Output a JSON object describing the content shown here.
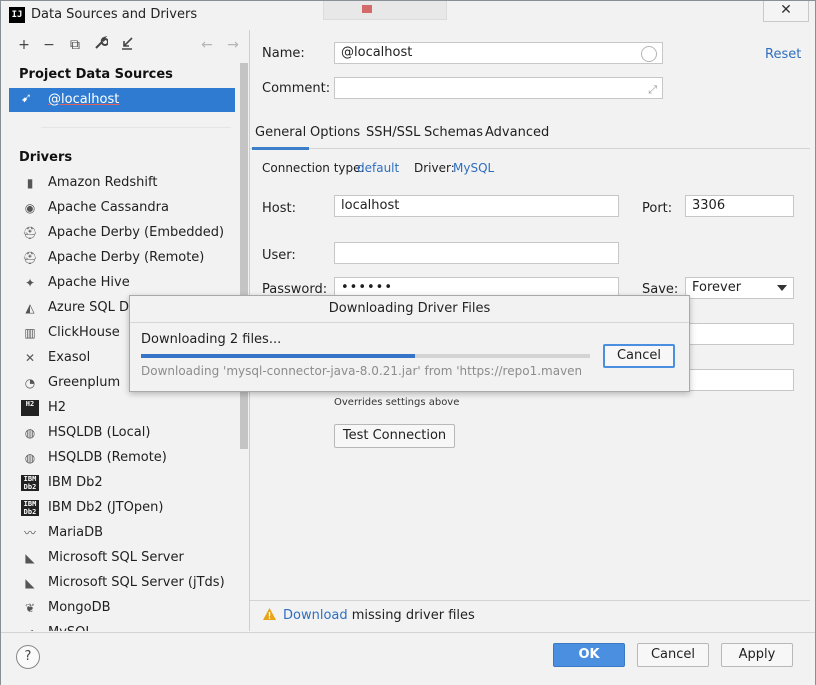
{
  "window": {
    "title": "Data Sources and Drivers",
    "app_icon_text": "IJ",
    "close_glyph": "✕"
  },
  "sidebar": {
    "toolbar": [
      {
        "icon": "plus-icon",
        "glyph": "+"
      },
      {
        "icon": "minus-icon",
        "glyph": "−"
      },
      {
        "icon": "copy-icon",
        "glyph": "⧉"
      },
      {
        "icon": "wrench-icon",
        "glyph": "🔧"
      },
      {
        "icon": "import-icon",
        "glyph": "⇲"
      },
      {
        "icon": "back-arrow-icon",
        "glyph": "←"
      },
      {
        "icon": "forward-arrow-icon",
        "glyph": "→"
      }
    ],
    "project_title": "Project Data Sources",
    "datasource": {
      "label": "@localhost",
      "icon": "mysql-dolphin-icon",
      "glyph": "➹"
    },
    "drivers_title": "Drivers",
    "drivers": [
      {
        "label": "Amazon Redshift",
        "icon": "redshift-icon",
        "glyph": "▮"
      },
      {
        "label": "Apache Cassandra",
        "icon": "cassandra-eye-icon",
        "glyph": "◉"
      },
      {
        "label": "Apache Derby (Embedded)",
        "icon": "derby-hat-icon",
        "glyph": "⛑"
      },
      {
        "label": "Apache Derby (Remote)",
        "icon": "derby-hat-icon",
        "glyph": "⛑"
      },
      {
        "label": "Apache Hive",
        "icon": "hive-bee-icon",
        "glyph": "✦"
      },
      {
        "label": "Azure SQL Database",
        "icon": "azure-icon",
        "glyph": "◭"
      },
      {
        "label": "ClickHouse",
        "icon": "clickhouse-bars-icon",
        "glyph": "▥"
      },
      {
        "label": "Exasol",
        "icon": "exasol-x-icon",
        "glyph": "✕"
      },
      {
        "label": "Greenplum",
        "icon": "greenplum-circle-icon",
        "glyph": "◔"
      },
      {
        "label": "H2",
        "icon": "h2-icon",
        "glyph": "H2",
        "boxed": true
      },
      {
        "label": "HSQLDB (Local)",
        "icon": "hsqldb-icon",
        "glyph": "◍"
      },
      {
        "label": "HSQLDB (Remote)",
        "icon": "hsqldb-icon",
        "glyph": "◍"
      },
      {
        "label": "IBM Db2",
        "icon": "ibm-db2-icon",
        "glyph": "IBM Db2",
        "boxed": true
      },
      {
        "label": "IBM Db2 (JTOpen)",
        "icon": "ibm-db2-icon",
        "glyph": "IBM Db2",
        "boxed": true
      },
      {
        "label": "MariaDB",
        "icon": "mariadb-seal-icon",
        "glyph": "〰"
      },
      {
        "label": "Microsoft SQL Server",
        "icon": "sqlserver-icon",
        "glyph": "◣"
      },
      {
        "label": "Microsoft SQL Server (jTds)",
        "icon": "sqlserver-icon",
        "glyph": "◣"
      },
      {
        "label": "MongoDB",
        "icon": "mongodb-leaf-icon",
        "glyph": "❦"
      },
      {
        "label": "MySQL",
        "icon": "mysql-dolphin-icon",
        "glyph": "➹"
      }
    ]
  },
  "form": {
    "name_label": "Name:",
    "name_value": "@localhost",
    "reset_label": "Reset",
    "comment_label": "Comment:",
    "comment_value": "",
    "tabs": [
      "General",
      "Options",
      "SSH/SSL",
      "Schemas",
      "Advanced"
    ],
    "active_tab": "General",
    "connection_type_label": "Connection type:",
    "connection_type_value": "default",
    "driver_label": "Driver:",
    "driver_value": "MySQL",
    "host_label": "Host:",
    "host_value": "localhost",
    "port_label": "Port:",
    "port_value": "3306",
    "user_label": "User:",
    "user_value": "",
    "password_label": "Password:",
    "password_value": "••••••",
    "save_label": "Save:",
    "save_value": "Forever",
    "overrides_note": "Overrides settings above",
    "test_connection_label": "Test Connection",
    "warning_link": "Download",
    "warning_text": " missing driver files"
  },
  "footer": {
    "help_glyph": "?",
    "ok_label": "OK",
    "cancel_label": "Cancel",
    "apply_label": "Apply"
  },
  "download_dialog": {
    "title": "Downloading Driver Files",
    "status": "Downloading 2 files...",
    "detail": "Downloading 'mysql-connector-java-8.0.21.jar' from 'https://repo1.maven...",
    "cancel_label": "Cancel",
    "progress": 0.61
  },
  "colors": {
    "selection": "#2f7bd2",
    "link": "#2f6fbf",
    "progress": "#3574c9",
    "warning": "#e8a317"
  }
}
